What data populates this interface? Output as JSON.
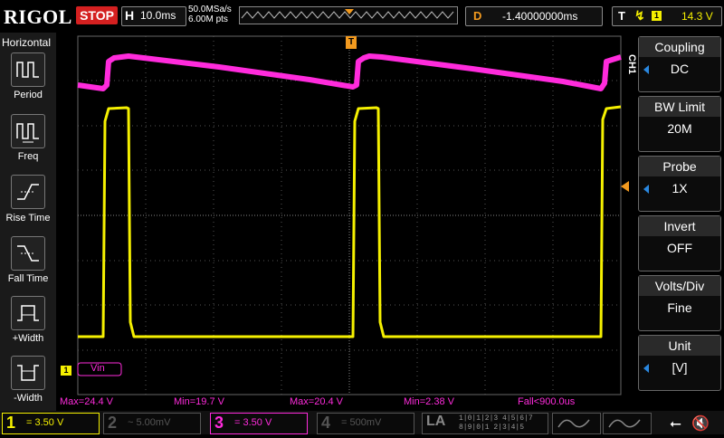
{
  "brand": "RIGOL",
  "run_state": "STOP",
  "timebase": {
    "label": "H",
    "value": "10.0ms"
  },
  "sample_rate": "50.0MSa/s",
  "memory_depth": "6.00M pts",
  "delay": {
    "label": "D",
    "value": "-1.40000000ms"
  },
  "trigger": {
    "label": "T",
    "channel": "1",
    "level": "14.3 V"
  },
  "menu_title": "Horizontal",
  "left_menu": [
    {
      "label": "Period"
    },
    {
      "label": "Freq"
    },
    {
      "label": "Rise Time"
    },
    {
      "label": "Fall Time"
    },
    {
      "label": "+Width"
    },
    {
      "label": "-Width"
    }
  ],
  "channel_tab": "CH1",
  "right_menu": [
    {
      "caption": "Coupling",
      "value": "DC"
    },
    {
      "caption": "BW Limit",
      "value": "20M"
    },
    {
      "caption": "Probe",
      "value": "1X"
    },
    {
      "caption": "Invert",
      "value": "OFF"
    },
    {
      "caption": "Volts/Div",
      "value": "Fine"
    },
    {
      "caption": "Unit",
      "value": "[V]"
    }
  ],
  "label_ch1": "Vin",
  "marker_trigger": "T",
  "marker_ch1": "1",
  "measurements": [
    "Max=24.4 V",
    "Min=19.7 V",
    "Max=20.4 V",
    "Min=2.38 V",
    "Fall<900.0us"
  ],
  "channels": [
    {
      "num": "1",
      "coupling": "=",
      "scale": "3.50 V",
      "color": "#f5f000"
    },
    {
      "num": "2",
      "coupling": "~",
      "scale": "5.00mV",
      "color": "#555555"
    },
    {
      "num": "3",
      "coupling": "=",
      "scale": "3.50 V",
      "color": "#ff2bdc"
    },
    {
      "num": "4",
      "coupling": "=",
      "scale": "500mV",
      "color": "#555555"
    }
  ],
  "la_label": "LA",
  "la_bits_top": "1|0|1|2|3 4|5|6|7",
  "la_bits_bottom": "8|9|0|1 2|3|4|5",
  "colors": {
    "ch1": "#f5f000",
    "ch3": "#ff2bdc",
    "accent": "#f39a1f",
    "grid": "#555555"
  }
}
